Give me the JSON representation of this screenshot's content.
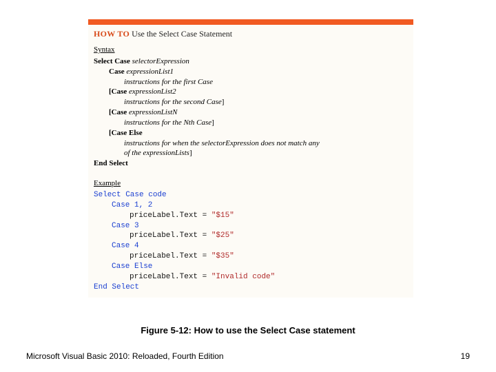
{
  "header": {
    "howto": "HOW TO",
    "title": "Use the Select Case Statement"
  },
  "syntax": {
    "label": "Syntax",
    "line1_a": "Select Case ",
    "line1_b": "selectorExpression",
    "case1_a": "Case ",
    "case1_b": "expressionList1",
    "case1_instr": "instructions for the first Case",
    "case2_a": "[Case ",
    "case2_b": "expressionList2",
    "case2_instr": "instructions for the second Case",
    "case2_close": "]",
    "caseN_a": "[Case ",
    "caseN_b": "expressionListN",
    "caseN_instr": "instructions for the Nth Case",
    "caseN_close": "]",
    "else_a": "[Case Else",
    "else_instr1": "instructions for when the selectorExpression does not match any",
    "else_instr2": "of the expressionLists",
    "else_close": "]",
    "end": "End Select"
  },
  "example": {
    "label": "Example",
    "l1": "Select Case code",
    "l2": "Case 1, 2",
    "l3a": "priceLabel.Text = ",
    "l3b": "\"$15\"",
    "l4": "Case 3",
    "l5a": "priceLabel.Text = ",
    "l5b": "\"$25\"",
    "l6": "Case 4",
    "l7a": "priceLabel.Text = ",
    "l7b": "\"$35\"",
    "l8": "Case Else",
    "l9a": "priceLabel.Text = ",
    "l9b": "\"Invalid code\"",
    "l10": "End Select"
  },
  "caption": "Figure 5-12: How to use the Select Case statement",
  "footer": "Microsoft Visual Basic 2010: Reloaded, Fourth Edition",
  "page": "19"
}
